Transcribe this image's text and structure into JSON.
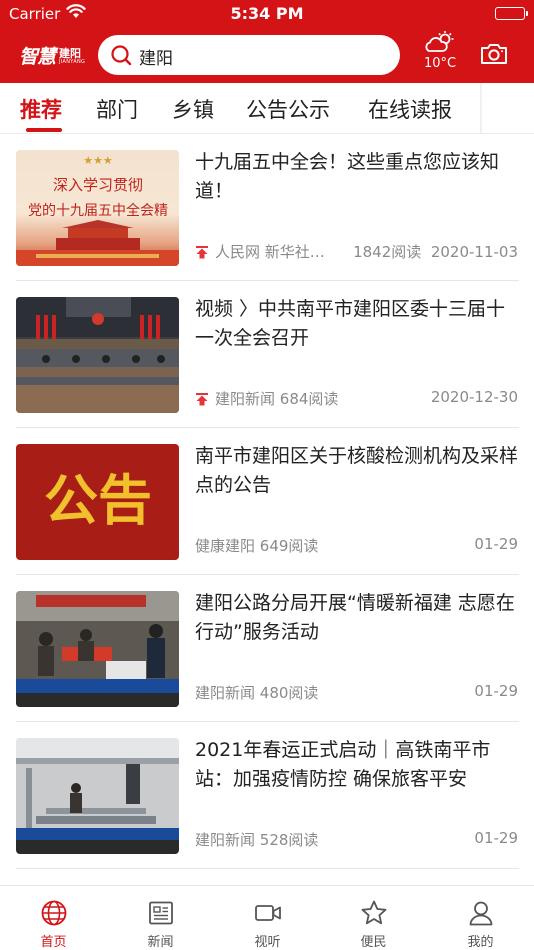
{
  "status_bar": {
    "carrier": "Carrier",
    "time": "5:34 PM"
  },
  "header": {
    "logo_main": "智慧",
    "logo_city": "建阳",
    "logo_pinyin": "JIANYANG",
    "search_text": "建阳",
    "temperature": "10°C",
    "brand_color": "#d41317"
  },
  "tabs": [
    "推荐",
    "部门",
    "乡镇",
    "公告公示",
    "在线读报"
  ],
  "articles": [
    {
      "title": "十九届五中全会！这些重点您应该知道！",
      "source": "人民网 新华社…",
      "reads": "1842阅读",
      "date": "2020-11-03",
      "pinned": true,
      "thumb_text_1": "深入学习贯彻",
      "thumb_text_2": "党的十九届五中全会精"
    },
    {
      "title": "视频 〉中共南平市建阳区委十三届十一次全会召开",
      "source": "建阳新闻",
      "reads": "684阅读",
      "date": "2020-12-30",
      "pinned": true
    },
    {
      "title": "南平市建阳区关于核酸检测机构及采样点的公告",
      "source": "健康建阳",
      "reads": "649阅读",
      "date": "01-29",
      "pinned": false,
      "thumb_text_1": "公告"
    },
    {
      "title": "建阳公路分局开展“情暖新福建 志愿在行动”服务活动",
      "source": "建阳新闻",
      "reads": "480阅读",
      "date": "01-29",
      "pinned": false
    },
    {
      "title": "2021年春运正式启动｜高铁南平市站：加强疫情防控 确保旅客平安",
      "source": "建阳新闻",
      "reads": "528阅读",
      "date": "01-29",
      "pinned": false
    }
  ],
  "bottom_nav": [
    {
      "label": "首页",
      "icon": "globe-icon",
      "active": true
    },
    {
      "label": "新闻",
      "icon": "newspaper-icon",
      "active": false
    },
    {
      "label": "视听",
      "icon": "video-icon",
      "active": false
    },
    {
      "label": "便民",
      "icon": "star-icon",
      "active": false
    },
    {
      "label": "我的",
      "icon": "user-icon",
      "active": false
    }
  ]
}
